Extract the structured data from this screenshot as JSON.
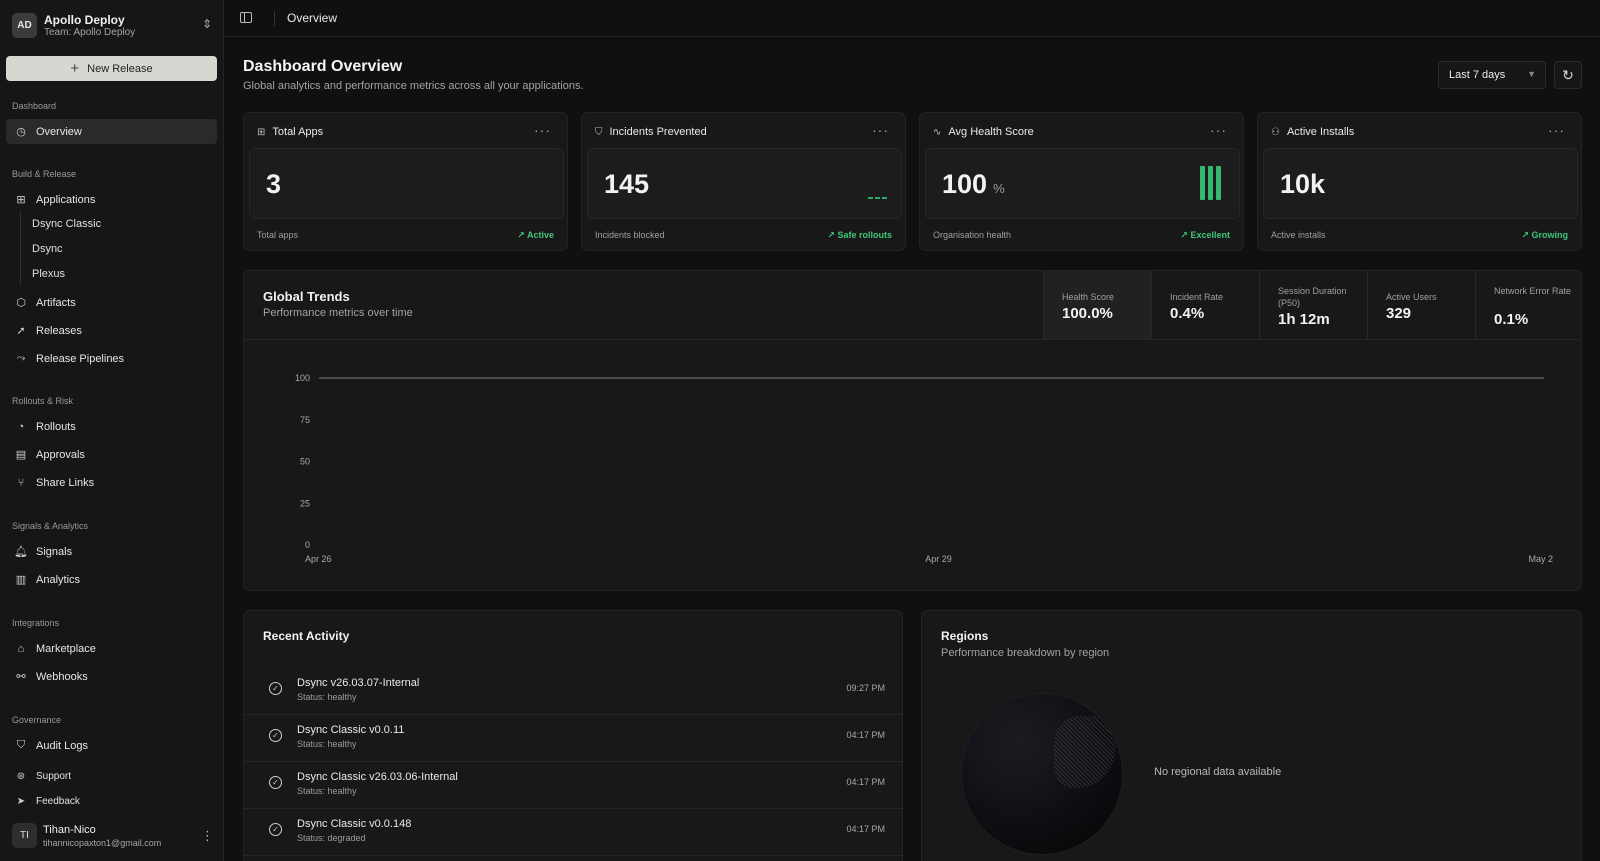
{
  "team": {
    "initials": "AD",
    "name": "Apollo Deploy",
    "subtitle": "Team: Apollo Deploy"
  },
  "new_release_label": "New Release",
  "nav": {
    "dashboard_label": "Dashboard",
    "overview": "Overview",
    "build_label": "Build & Release",
    "applications": "Applications",
    "applications_children": [
      "Dsync Classic",
      "Dsync",
      "Plexus"
    ],
    "artifacts": "Artifacts",
    "releases": "Releases",
    "release_pipelines": "Release Pipelines",
    "rollouts_label": "Rollouts & Risk",
    "rollouts": "Rollouts",
    "approvals": "Approvals",
    "share_links": "Share Links",
    "signals_label": "Signals & Analytics",
    "signals": "Signals",
    "analytics": "Analytics",
    "integrations_label": "Integrations",
    "marketplace": "Marketplace",
    "webhooks": "Webhooks",
    "governance_label": "Governance",
    "audit_logs": "Audit Logs",
    "support": "Support",
    "feedback": "Feedback"
  },
  "user": {
    "initials": "TI",
    "name": "Tihan-Nico",
    "email": "tihannicopaxton1@gmail.com"
  },
  "topbar": {
    "breadcrumb": "Overview"
  },
  "header": {
    "title": "Dashboard Overview",
    "subtitle": "Global analytics and performance metrics across all your applications.",
    "range": "Last 7 days"
  },
  "stats": [
    {
      "title": "Total Apps",
      "value": "3",
      "unit": "",
      "label": "Total apps",
      "trend": "Active"
    },
    {
      "title": "Incidents Prevented",
      "value": "145",
      "unit": "",
      "label": "Incidents blocked",
      "trend": "Safe rollouts"
    },
    {
      "title": "Avg Health Score",
      "value": "100",
      "unit": "%",
      "label": "Organisation health",
      "trend": "Excellent"
    },
    {
      "title": "Active Installs",
      "value": "10k",
      "unit": "",
      "label": "Active installs",
      "trend": "Growing"
    }
  ],
  "trends": {
    "title": "Global Trends",
    "subtitle": "Performance metrics over time",
    "metrics": [
      {
        "label": "Health Score",
        "value": "100.0%"
      },
      {
        "label": "Incident Rate",
        "value": "0.4%"
      },
      {
        "label": "Session Duration (P50)",
        "value": "1h 12m"
      },
      {
        "label": "Active Users",
        "value": "329"
      },
      {
        "label": "Network Error Rate",
        "value": "0.1%"
      }
    ]
  },
  "chart_data": {
    "type": "line",
    "x": [
      "Apr 26",
      "Apr 29",
      "May 2"
    ],
    "series": [
      {
        "values": [
          100,
          100,
          100
        ]
      }
    ],
    "yticks": [
      0,
      25,
      50,
      75,
      100
    ],
    "ylim": [
      0,
      100
    ],
    "grid": false
  },
  "activity": {
    "title": "Recent Activity",
    "items": [
      {
        "name": "Dsync v26.03.07-Internal",
        "status": "Status: healthy",
        "time": "09:27 PM"
      },
      {
        "name": "Dsync Classic v0.0.11",
        "status": "Status: healthy",
        "time": "04:17 PM"
      },
      {
        "name": "Dsync Classic v26.03.06-Internal",
        "status": "Status: healthy",
        "time": "04:17 PM"
      },
      {
        "name": "Dsync Classic v0.0.148",
        "status": "Status: degraded",
        "time": "04:17 PM"
      }
    ]
  },
  "regions": {
    "title": "Regions",
    "subtitle": "Performance breakdown by region",
    "empty": "No regional data available"
  },
  "colors": {
    "accent_green": "#3ec77c",
    "background": "#101010",
    "card": "#181818"
  },
  "icons": {
    "team_switch": "chevron-updown-icon",
    "overview": "gauge-icon",
    "applications": "grid-icon",
    "artifacts": "cube-icon",
    "releases": "rocket-icon",
    "pipelines": "workflow-icon",
    "rollouts": "clock-icon",
    "approvals": "clipboard-icon",
    "share_links": "git-branch-icon",
    "signals": "bell-icon",
    "analytics": "bar-chart-icon",
    "marketplace": "store-icon",
    "webhooks": "webhook-icon",
    "audit_logs": "shield-icon",
    "support": "lifebuoy-icon",
    "feedback": "send-icon"
  }
}
